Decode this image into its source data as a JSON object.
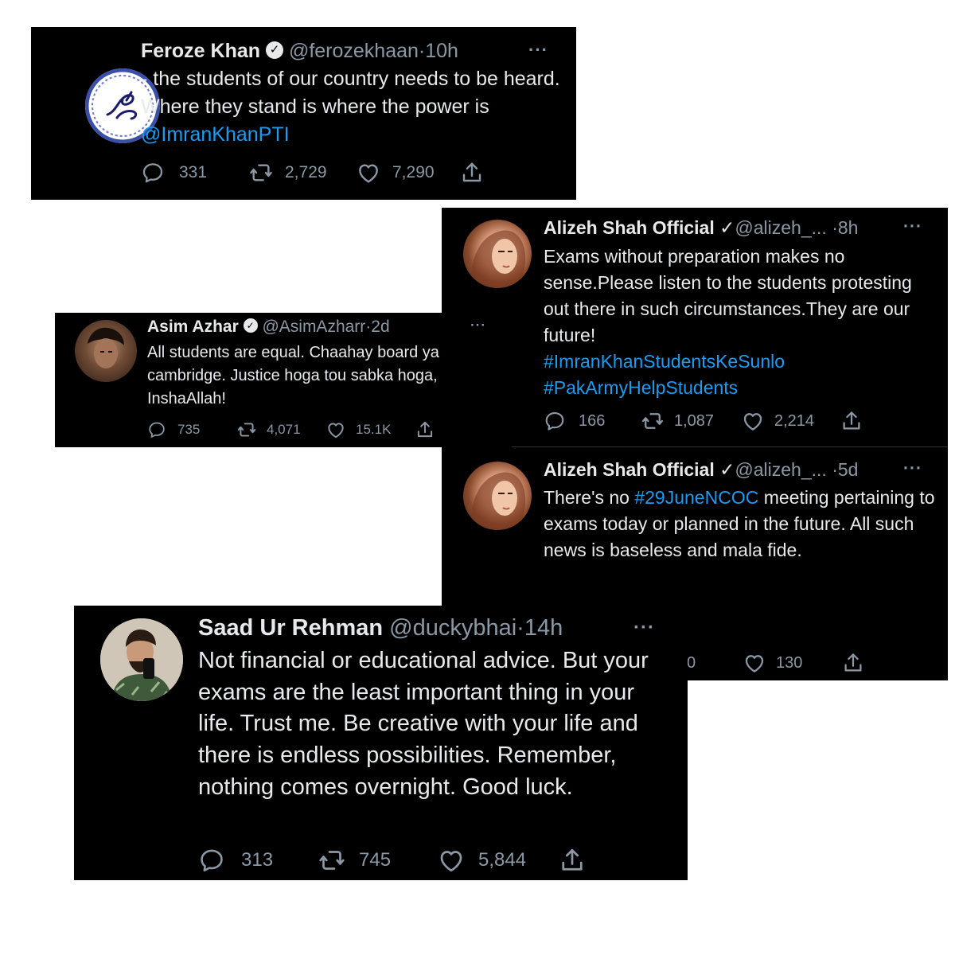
{
  "tweets": {
    "feroze": {
      "name": "Feroze Khan",
      "handle": "@ferozekhaan",
      "dot": "·",
      "time": "10h",
      "more": "···",
      "text_parts": [
        "- the students of our country needs to be heard. Where they stand is where the power is ",
        "@ImranKhanPTI"
      ],
      "replies": "331",
      "retweets": "2,729",
      "likes": "7,290"
    },
    "alizeh1": {
      "name": "Alizeh Shah Official",
      "check": "✓",
      "handle": "@alizeh_...",
      "dot": "·",
      "time": "8h",
      "more": "···",
      "text": "Exams without preparation makes no sense.Please listen to the students protesting out there in such circumstances.They are our future!",
      "hashtag1": "#ImranKhanStudentsKeSunlo",
      "hashtag2": "#PakArmyHelpStudents",
      "replies": "166",
      "retweets": "1,087",
      "likes": "2,214"
    },
    "asim": {
      "name": "Asim Azhar",
      "handle": "@AsimAzharr",
      "dot": "·",
      "time": "2d",
      "more": "···",
      "text": "All students are equal. Chaahay board ya cambridge. Justice hoga tou sabka hoga, InshaAllah!",
      "replies": "735",
      "retweets": "4,071",
      "likes": "15.1K"
    },
    "alizeh2": {
      "name": "Alizeh Shah Official",
      "check": "✓",
      "handle": "@alizeh_...",
      "dot": "·",
      "time": "5d",
      "more": "···",
      "text_before": "There's no ",
      "hashtag": "#29JuneNCOC",
      "text_after": " meeting pertaining to exams today or planned in the future. All such news is baseless and mala fide.",
      "replies_partial": "0",
      "likes": "130"
    },
    "saad": {
      "name": "Saad Ur Rehman",
      "handle": "@duckybhai",
      "dot": "·",
      "time": "14h",
      "more": "···",
      "text": "Not financial or educational advice. But your exams are the least important thing in your life. Trust me. Be creative with your life and there is endless possibilities. Remember, nothing comes overnight. Good luck.",
      "replies": "313",
      "retweets": "745",
      "likes": "5,844"
    }
  },
  "icons": [
    "reply-icon",
    "retweet-icon",
    "like-icon",
    "share-icon",
    "verified-icon",
    "more-icon"
  ],
  "colors": {
    "background": "#000000",
    "text": "#e7e9ea",
    "muted": "#8b98a5",
    "link": "#1d9bf0"
  }
}
